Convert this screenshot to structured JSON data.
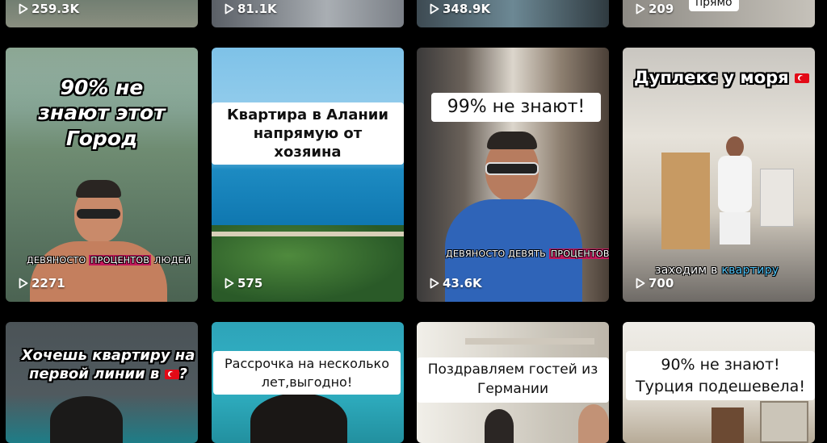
{
  "row_top": [
    {
      "views": "259.3K"
    },
    {
      "views": "81.1K"
    },
    {
      "views": "348.9K"
    },
    {
      "views": "209",
      "caption_fragment": "прямо"
    }
  ],
  "row_mid": [
    {
      "caption": "90% не знают этот Город",
      "subtitle_pre": "ДЕВЯНОСТО ",
      "subtitle_hl": "ПРОЦЕНТОВ",
      "subtitle_post": " ЛЮДЕЙ",
      "views": "2271"
    },
    {
      "caption": "Квартира в Алании напрямую от хозяина",
      "views": "575"
    },
    {
      "caption": "99%  не знают!",
      "subtitle_pre": "ДЕВЯНОСТО ДЕВЯТЬ ",
      "subtitle_hl": "ПРОЦЕНТОВ",
      "subtitle_post": "",
      "views": "43.6K"
    },
    {
      "caption": "Дуплекс у моря",
      "flag_icon": "turkey-flag-icon",
      "subtitle_pre": "заходим в ",
      "subtitle_hl": "квартиру",
      "subtitle_post": "",
      "views": "700"
    }
  ],
  "row_bottom": [
    {
      "caption_line1": "Хочешь квартиру на",
      "caption_line2": "первой линии в",
      "caption_end": "?",
      "flag_icon": "turkey-flag-icon"
    },
    {
      "caption_line1": "Рассрочка на несколько",
      "caption_line2": "лет,выгодно!"
    },
    {
      "caption_line1": "Поздравляем гостей из",
      "caption_line2": "Германии"
    },
    {
      "caption_line1": "90% не знают!",
      "caption_line2": "Турция подешевела!"
    }
  ],
  "colors": {
    "background": "#000000",
    "highlight": "#c2185b",
    "highlight_blue": "#1976d2"
  }
}
